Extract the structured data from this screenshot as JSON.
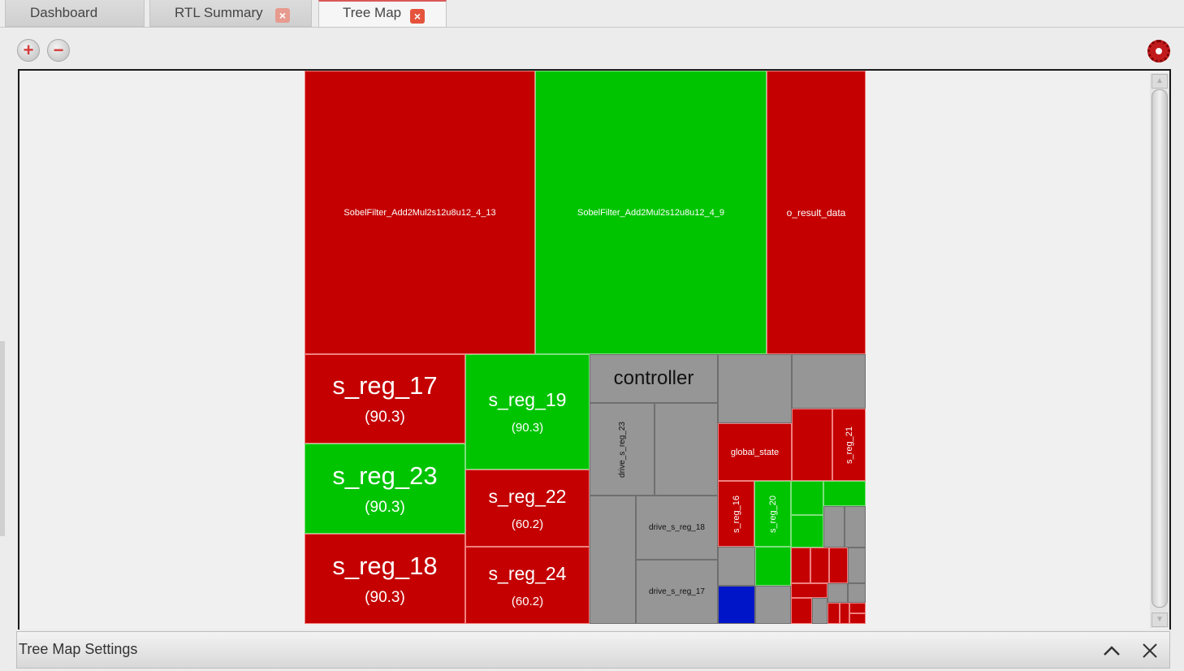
{
  "tabs": [
    {
      "label": "Dashboard",
      "closable": false
    },
    {
      "label": "RTL Summary",
      "closable": true
    },
    {
      "label": "Tree Map",
      "closable": true,
      "active": true
    }
  ],
  "toolbar": {
    "zoom_in": "+",
    "zoom_out": "−"
  },
  "treemap": {
    "cells": {
      "sobel13": {
        "name": "SobelFilter_Add2Mul2s12u8u12_4_13",
        "status": "red"
      },
      "sobel9": {
        "name": "SobelFilter_Add2Mul2s12u8u12_4_9",
        "status": "green"
      },
      "o_result_data": {
        "name": "o_result_data",
        "status": "red"
      },
      "s_reg_17": {
        "name": "s_reg_17",
        "value": "(90.3)",
        "status": "red"
      },
      "s_reg_19": {
        "name": "s_reg_19",
        "value": "(90.3)",
        "status": "green"
      },
      "s_reg_23": {
        "name": "s_reg_23",
        "value": "(90.3)",
        "status": "green"
      },
      "s_reg_22": {
        "name": "s_reg_22",
        "value": "(60.2)",
        "status": "red"
      },
      "s_reg_18": {
        "name": "s_reg_18",
        "value": "(90.3)",
        "status": "red"
      },
      "s_reg_24": {
        "name": "s_reg_24",
        "value": "(60.2)",
        "status": "red"
      },
      "controller": {
        "name": "controller",
        "status": "gray"
      },
      "drive_s_reg_23": {
        "name": "drive_s_reg_23",
        "status": "gray"
      },
      "drive_s_reg_18": {
        "name": "drive_s_reg_18",
        "status": "gray"
      },
      "drive_s_reg_17": {
        "name": "drive_s_reg_17",
        "status": "gray"
      },
      "global_state": {
        "name": "global_state",
        "status": "red"
      },
      "s_reg_21": {
        "name": "s_reg_21",
        "status": "red"
      },
      "s_reg_16": {
        "name": "s_reg_16",
        "status": "red"
      },
      "s_reg_20": {
        "name": "s_reg_20",
        "status": "green"
      }
    },
    "colors": {
      "red": "#c40000",
      "green": "#00c400",
      "gray": "#969696",
      "blue": "#0015c8"
    }
  },
  "settings_panel": {
    "title": "Tree Map Settings",
    "collapse_icon": "chevron-up-icon",
    "close_icon": "close-icon"
  },
  "icons": {
    "gear": "gear-icon",
    "zoom_in": "plus-circle-icon",
    "zoom_out": "minus-circle-icon"
  }
}
